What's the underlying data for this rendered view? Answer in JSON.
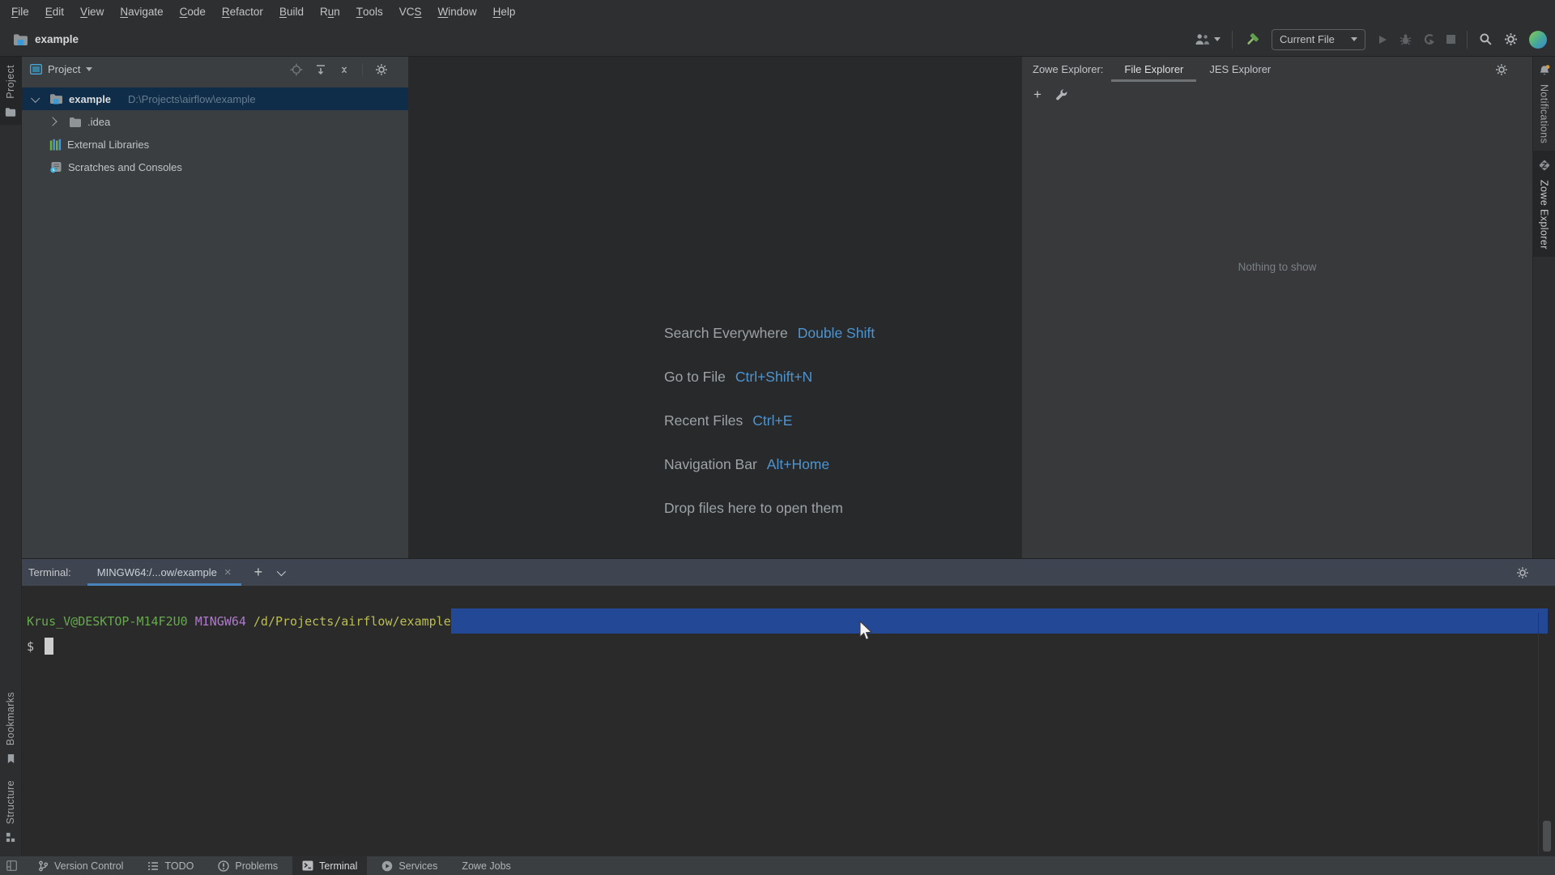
{
  "colors": {
    "accent_blue": "#4f94cf",
    "selection_blue": "#224896",
    "terminal_green": "#67aa4e",
    "terminal_purple": "#ad7bc8",
    "terminal_yellow": "#bcbe51",
    "hammer_green": "#63a04e",
    "notification_orange": "#d49a43",
    "tree_selection": "#0f2d49"
  },
  "menu_bar": {
    "items": [
      {
        "pre": "",
        "mn": "F",
        "post": "ile"
      },
      {
        "pre": "",
        "mn": "E",
        "post": "dit"
      },
      {
        "pre": "",
        "mn": "V",
        "post": "iew"
      },
      {
        "pre": "",
        "mn": "N",
        "post": "avigate"
      },
      {
        "pre": "",
        "mn": "C",
        "post": "ode"
      },
      {
        "pre": "",
        "mn": "R",
        "post": "efactor"
      },
      {
        "pre": "",
        "mn": "B",
        "post": "uild"
      },
      {
        "pre": "R",
        "mn": "u",
        "post": "n"
      },
      {
        "pre": "",
        "mn": "T",
        "post": "ools"
      },
      {
        "pre": "VC",
        "mn": "S",
        "post": ""
      },
      {
        "pre": "",
        "mn": "W",
        "post": "indow"
      },
      {
        "pre": "",
        "mn": "H",
        "post": "elp"
      }
    ]
  },
  "title_row": {
    "project_name": "example",
    "run_config": "Current File"
  },
  "left_strip": {
    "project": "Project",
    "bookmarks": "Bookmarks",
    "structure": "Structure"
  },
  "right_strip": {
    "notifications": "Notifications",
    "zowe": "Zowe Explorer"
  },
  "project_panel": {
    "title": "Project",
    "rows": [
      {
        "label": "example",
        "path": "D:\\Projects\\airflow\\example"
      },
      {
        "label": ".idea"
      },
      {
        "label": "External Libraries"
      },
      {
        "label": "Scratches and Consoles"
      }
    ]
  },
  "editor": {
    "shortcuts": [
      {
        "label": "Search Everywhere",
        "keys": "Double Shift"
      },
      {
        "label": "Go to File",
        "keys": "Ctrl+Shift+N"
      },
      {
        "label": "Recent Files",
        "keys": "Ctrl+E"
      },
      {
        "label": "Navigation Bar",
        "keys": "Alt+Home"
      },
      {
        "label": "Drop files here to open them",
        "keys": ""
      }
    ]
  },
  "zowe_panel": {
    "label": "Zowe Explorer:",
    "tabs": [
      {
        "label": "File Explorer"
      },
      {
        "label": "JES Explorer"
      }
    ],
    "empty_text": "Nothing to show"
  },
  "terminal_panel": {
    "label": "Terminal:",
    "tab_title": "MINGW64:/...ow/example",
    "prompt_user": "Krus_V@DESKTOP-M14F2U0",
    "prompt_env": "MINGW64",
    "prompt_path": "/d/Projects/airflow/example",
    "prompt_symbol": "$"
  },
  "status_bar": {
    "items": [
      "Version Control",
      "TODO",
      "Problems",
      "Terminal",
      "Services",
      "Zowe Jobs"
    ]
  }
}
